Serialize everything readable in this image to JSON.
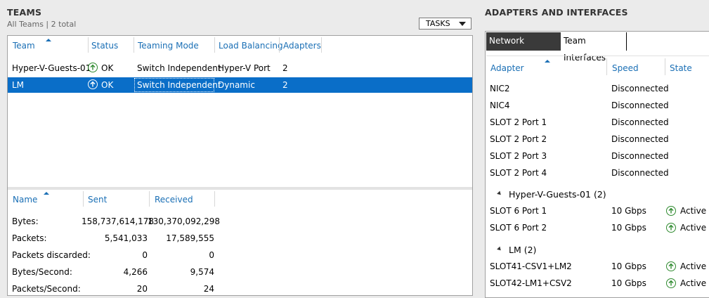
{
  "teams": {
    "title": "TEAMS",
    "subtitle": "All Teams | 2 total",
    "tasks_label": "TASKS",
    "columns": [
      "Team",
      "Status",
      "Teaming Mode",
      "Load Balancing",
      "Adapters"
    ],
    "rows": [
      {
        "team": "Hyper-V-Guests-01",
        "status": "OK",
        "mode": "Switch Independent",
        "lb": "Hyper-V Port",
        "adapters": "2"
      },
      {
        "team": "LM",
        "status": "OK",
        "mode": "Switch Independent",
        "lb": "Dynamic",
        "adapters": "2"
      }
    ],
    "stats": {
      "columns": [
        "Name",
        "Sent",
        "Received"
      ],
      "rows": [
        {
          "name": "Bytes:",
          "sent": "158,737,614,178",
          "received": "130,370,092,298"
        },
        {
          "name": "Packets:",
          "sent": "5,541,033",
          "received": "17,589,555"
        },
        {
          "name": "Packets discarded:",
          "sent": "0",
          "received": "0"
        },
        {
          "name": "Bytes/Second:",
          "sent": "4,266",
          "received": "9,574"
        },
        {
          "name": "Packets/Second:",
          "sent": "20",
          "received": "24"
        }
      ]
    }
  },
  "adapters": {
    "title": "ADAPTERS AND INTERFACES",
    "tabs": [
      "Network Adapters",
      "Team Interfaces"
    ],
    "columns": [
      "Adapter",
      "Speed",
      "State"
    ],
    "ungrouped": [
      {
        "name": "NIC2",
        "speed": "Disconnected",
        "state": ""
      },
      {
        "name": "NIC4",
        "speed": "Disconnected",
        "state": ""
      },
      {
        "name": "SLOT 2 Port 1",
        "speed": "Disconnected",
        "state": ""
      },
      {
        "name": "SLOT 2 Port 2",
        "speed": "Disconnected",
        "state": ""
      },
      {
        "name": "SLOT 2 Port 3",
        "speed": "Disconnected",
        "state": ""
      },
      {
        "name": "SLOT 2 Port 4",
        "speed": "Disconnected",
        "state": ""
      }
    ],
    "groups": [
      {
        "label": "Hyper-V-Guests-01 (2)",
        "items": [
          {
            "name": "SLOT 6 Port 1",
            "speed": "10 Gbps",
            "state": "Active"
          },
          {
            "name": "SLOT 6 Port 2",
            "speed": "10 Gbps",
            "state": "Active"
          }
        ]
      },
      {
        "label": "LM (2)",
        "items": [
          {
            "name": "SLOT41-CSV1+LM2",
            "speed": "10 Gbps",
            "state": "Active"
          },
          {
            "name": "SLOT42-LM1+CSV2",
            "speed": "10 Gbps",
            "state": "Active"
          }
        ]
      }
    ]
  },
  "colors": {
    "accent": "#1a6fb5",
    "selection": "#0a6ec8",
    "ok_green": "#2f8a2f"
  }
}
